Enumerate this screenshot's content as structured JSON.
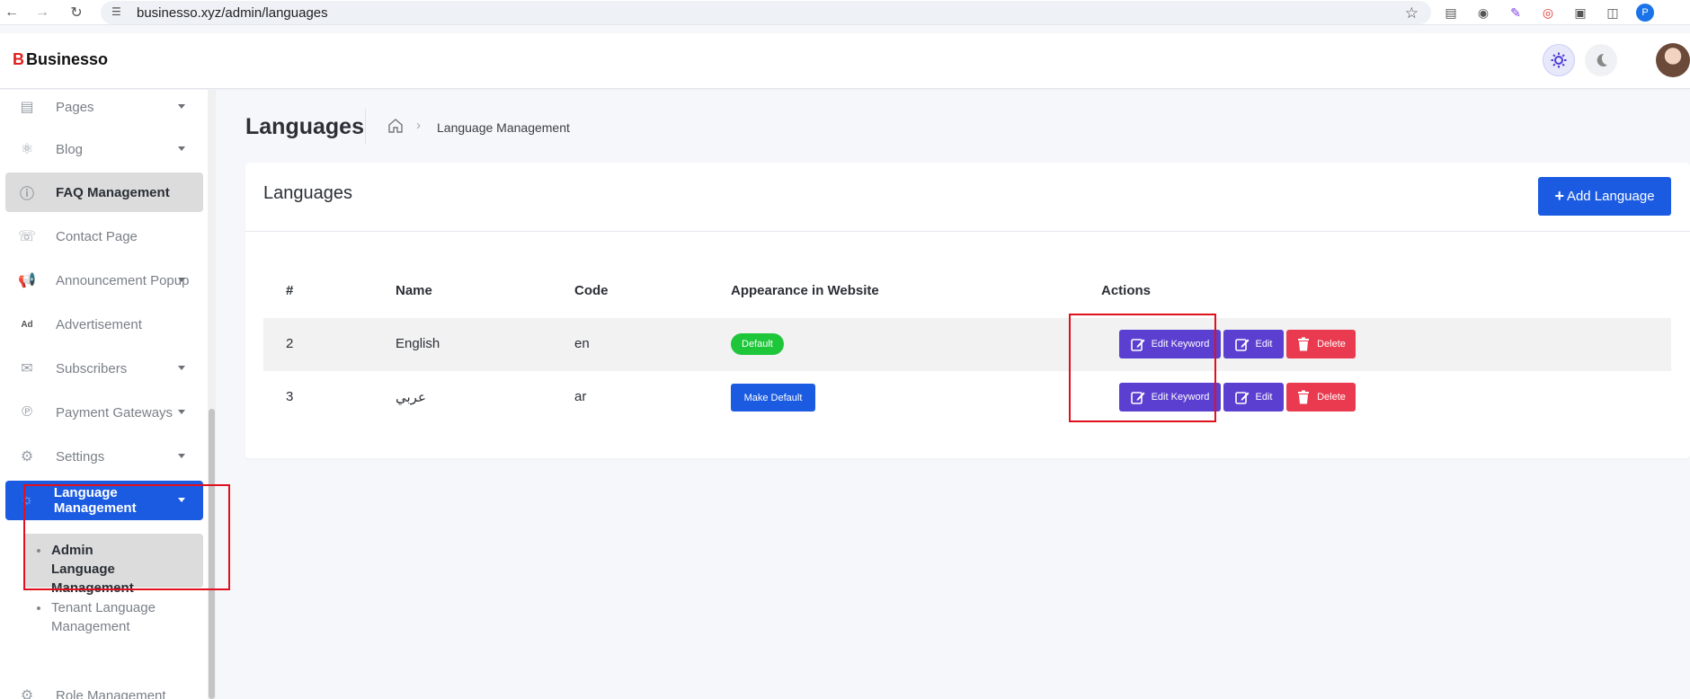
{
  "browser": {
    "url": "businesso.xyz/admin/languages",
    "profile_initial": "P"
  },
  "header": {
    "logo_mark": "B",
    "logo_text": "Businesso"
  },
  "sidebar": {
    "items": [
      {
        "label": "Pages",
        "icon": "page-icon"
      },
      {
        "label": "Blog",
        "icon": "blog-icon"
      },
      {
        "label": "FAQ Management",
        "icon": "question-icon"
      },
      {
        "label": "Contact Page",
        "icon": "whatsapp-icon"
      },
      {
        "label": "Announcement Popup",
        "icon": "megaphone-icon"
      },
      {
        "label": "Advertisement",
        "icon": "ad-icon"
      },
      {
        "label": "Subscribers",
        "icon": "envelope-icon"
      },
      {
        "label": "Payment Gateways",
        "icon": "paypal-icon"
      },
      {
        "label": "Settings",
        "icon": "gear-icon"
      },
      {
        "label": "Language Management",
        "icon": "language-icon"
      }
    ],
    "sub_items": [
      {
        "label": "Admin Language Management"
      },
      {
        "label": "Tenant Language Management"
      }
    ],
    "partial_item": "Role Management"
  },
  "main": {
    "page_title": "Languages",
    "breadcrumb": "Language Management",
    "card_title": "Languages",
    "add_button": "Add Language",
    "columns": [
      "#",
      "Name",
      "Code",
      "Appearance in Website",
      "Actions"
    ],
    "rows": [
      {
        "id": "2",
        "name": "English",
        "code": "en",
        "appearance": "Default",
        "is_default": true
      },
      {
        "id": "3",
        "name": "عربي",
        "code": "ar",
        "appearance": "Make Default",
        "is_default": false
      }
    ],
    "actions": {
      "edit_keyword": "Edit Keyword",
      "edit": "Edit",
      "delete": "Delete"
    }
  },
  "colors": {
    "primary": "#1b5be2",
    "purple": "#5a3fd1",
    "danger": "#ea3a4f",
    "success": "#1ec63a",
    "highlight": "#e0101e"
  }
}
